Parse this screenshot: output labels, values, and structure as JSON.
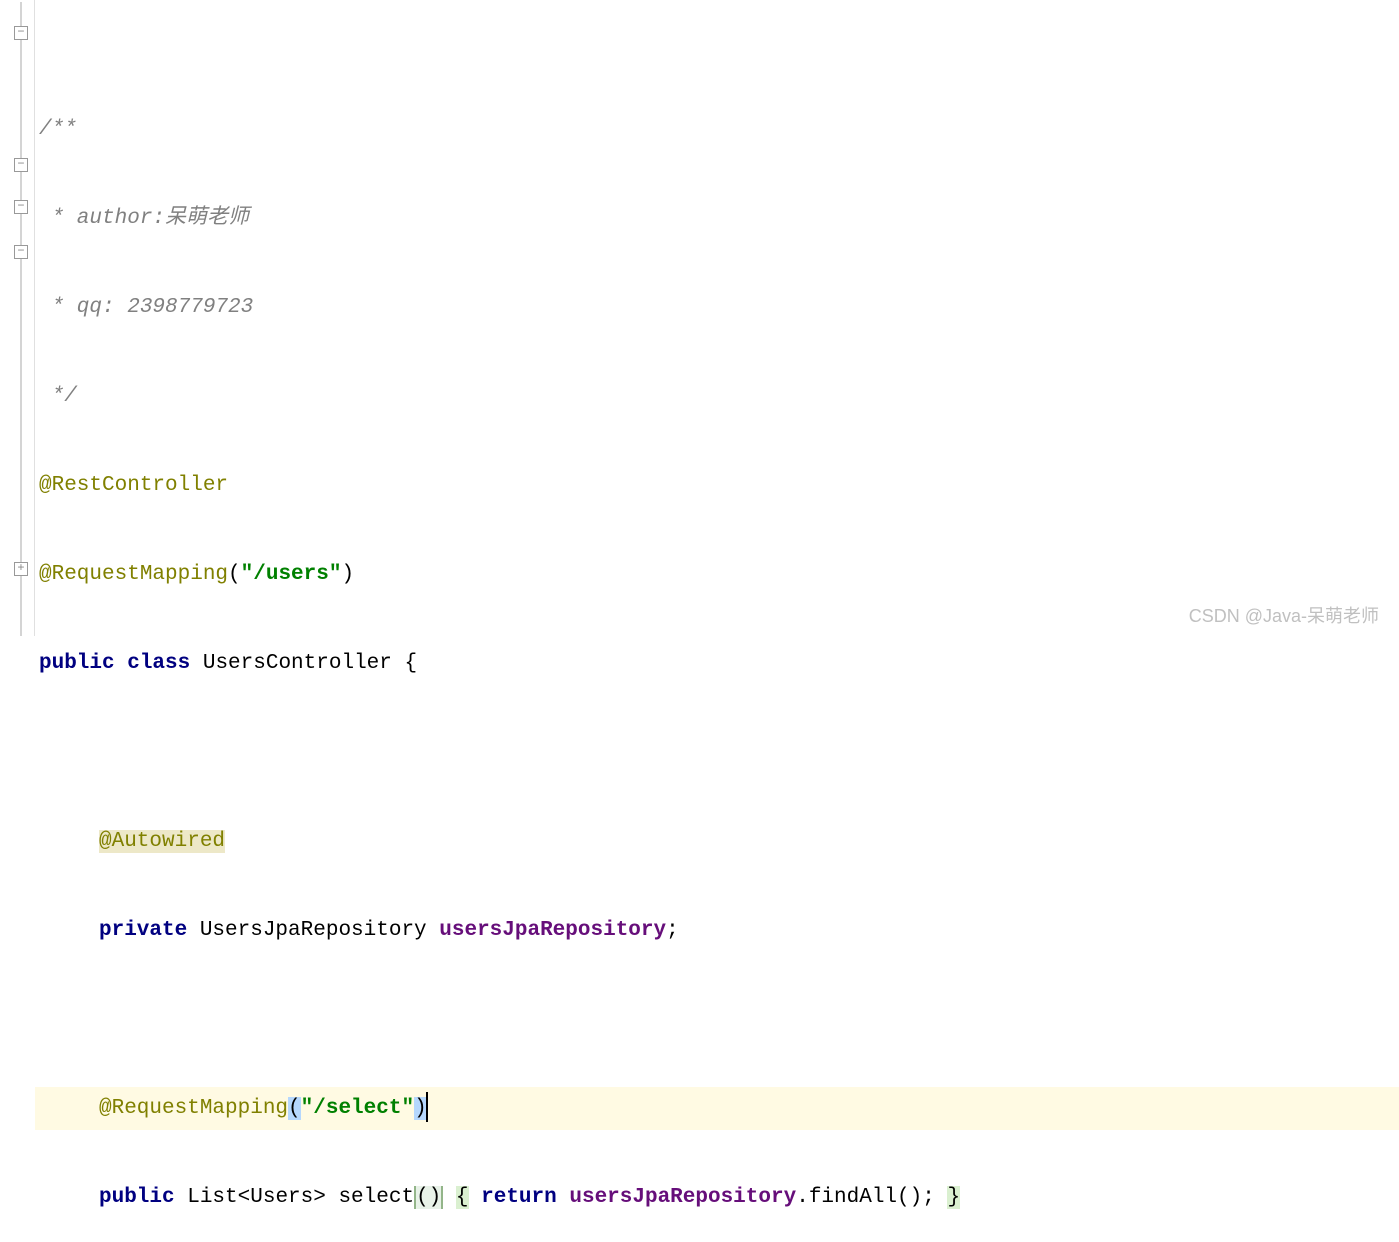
{
  "gutter": {
    "minus": "−",
    "plus": "+"
  },
  "code": {
    "l1_comment_open": "/**",
    "l2_author": " * author:呆萌老师",
    "l3_qq": " * qq: 2398779723",
    "l4_comment_close": " */",
    "l5_rest": "@RestController",
    "l6_reqmap": "@RequestMapping",
    "l6_open": "(",
    "l6_str": "\"/users\"",
    "l6_close": ")",
    "l7_public": "public",
    "l7_class": " class ",
    "l7_name": "UsersController ",
    "l7_brace": "{",
    "l9_autowired": "@Autowired",
    "l10_private": "private",
    "l10_type": " UsersJpaRepository ",
    "l10_field": "usersJpaRepository",
    "l10_semi": ";",
    "l12_reqmap": "@RequestMapping",
    "l12_open": "(",
    "l12_str": "\"/select\"",
    "l12_close": ")",
    "l13_public": "public",
    "l13_list": " List<Users> ",
    "l13_method": "select",
    "l13_parens": "()",
    "l13_sp": " ",
    "l13_obrace": "{",
    "l13_sp2": " ",
    "l13_return": "return",
    "l13_sp3": " ",
    "l13_field": "usersJpaRepository",
    "l13_dot": ".",
    "l13_findall": "findAll",
    "l13_parens2": "()",
    "l13_semi": ";",
    "l13_sp4": " ",
    "l13_cbrace": "}"
  },
  "watermark": "CSDN @Java-呆萌老师"
}
